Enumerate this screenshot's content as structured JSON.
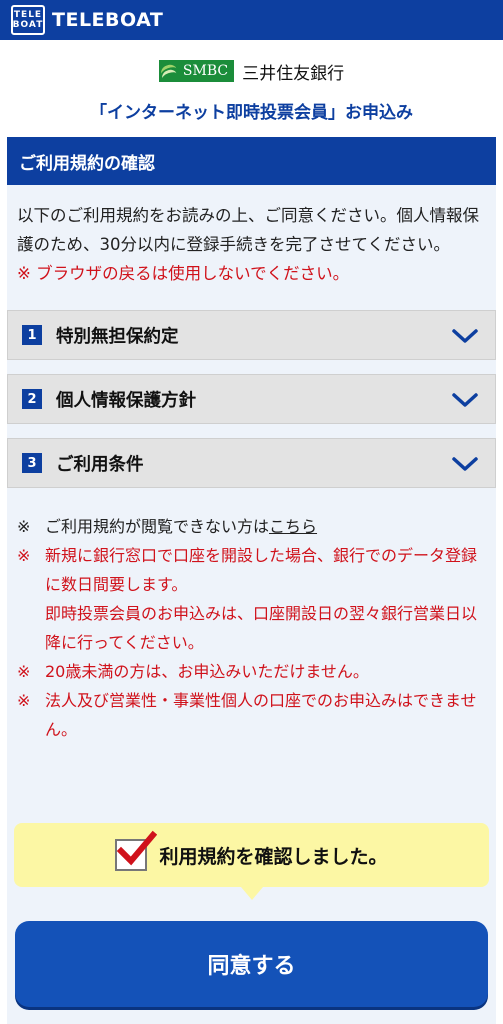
{
  "header": {
    "logo_line1": "TELE",
    "logo_line2": "BOAT",
    "brand": "TELEBOAT"
  },
  "bank": {
    "logo_text": "SMBC",
    "name": "三井住友銀行"
  },
  "app_title": "「インターネット即時投票会員」お申込み",
  "section": {
    "title": "ご利用規約の確認"
  },
  "intro": {
    "text": "以下のご利用規約をお読みの上、ご同意ください。個人情報保護のため、30分以内に登録手続きを完了させてください。",
    "warning": "※ ブラウザの戻るは使用しないでください。"
  },
  "accordion": [
    {
      "num": "1",
      "title": "特別無担保約定"
    },
    {
      "num": "2",
      "title": "個人情報保護方針"
    },
    {
      "num": "3",
      "title": "ご利用条件"
    }
  ],
  "notes": {
    "mark": "※",
    "note1_prefix": "ご利用規約が閲覧できない方は",
    "note1_link": "こちら",
    "note2": "新規に銀行窓口で口座を開設した場合、銀行でのデータ登録に数日間要します。",
    "note2b": "即時投票会員のお申込みは、口座開設日の翌々銀行営業日以降に行ってください。",
    "note3": "20歳未満の方は、お申込みいただけません。",
    "note4": "法人及び営業性・事業性個人の口座でのお申込みはできません。"
  },
  "confirm": {
    "label": "利用規約を確認しました。"
  },
  "agree_button": "同意する",
  "colors": {
    "primary": "#0d3fa0",
    "warning": "#d0121b",
    "highlight": "#fcf7a4"
  }
}
